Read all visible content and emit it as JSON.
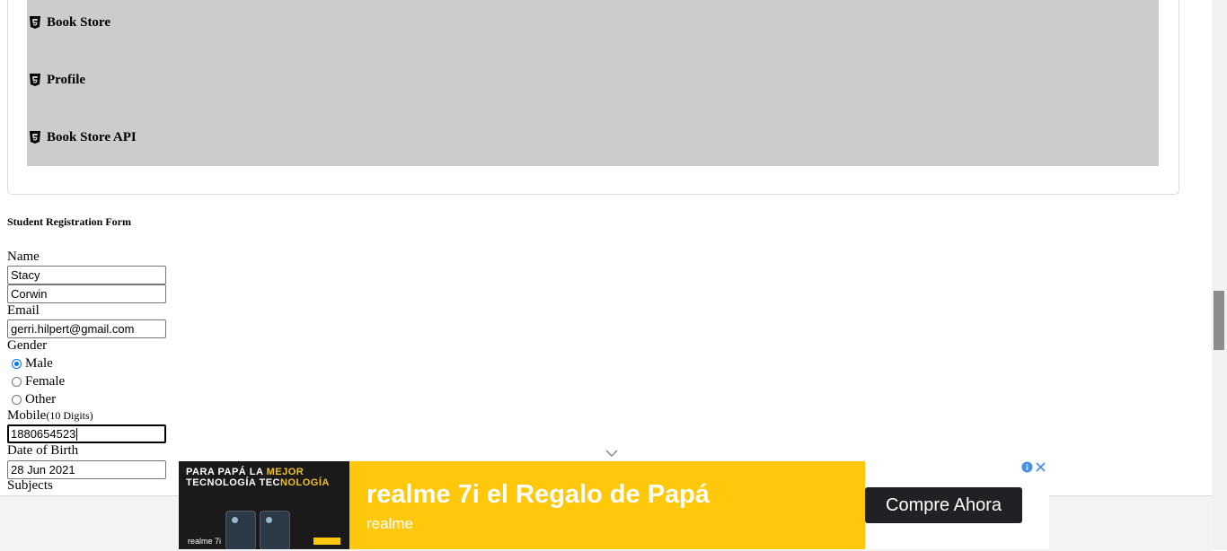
{
  "sidebar": {
    "items": [
      {
        "label": "Book Store",
        "icon": "html5-icon"
      },
      {
        "label": "Profile",
        "icon": "html5-icon"
      },
      {
        "label": "Book Store API",
        "icon": "html5-icon"
      }
    ]
  },
  "form": {
    "title": "Student Registration Form",
    "name_label": "Name",
    "first_name": "Stacy",
    "last_name": "Corwin",
    "email_label": "Email",
    "email": "gerri.hilpert@gmail.com",
    "gender_label": "Gender",
    "gender_options": [
      "Male",
      "Female",
      "Other"
    ],
    "gender_selected": "Male",
    "mobile_label": "Mobile",
    "mobile_hint": "(10 Digits)",
    "mobile": "1880654523",
    "dob_label": "Date of Birth",
    "dob": "28 Jun 2021",
    "subjects_label": "Subjects"
  },
  "ad": {
    "image_text_line1_a": "PARA PAPÁ LA ",
    "image_text_line1_b": "MEJOR",
    "image_text_line2_a": "TECNOLOGÍA TEC",
    "image_text_line2_b": "NOLOGÍA",
    "image_logo": "realme 7i",
    "headline": "realme 7i el Regalo de Papá",
    "brand": "realme",
    "cta": "Compre Ahora"
  },
  "colors": {
    "menu_bg": "#cccccc",
    "ad_yellow": "#ffc80a",
    "radio_accent": "#0075ff",
    "ad_info": "#4a90e2"
  }
}
